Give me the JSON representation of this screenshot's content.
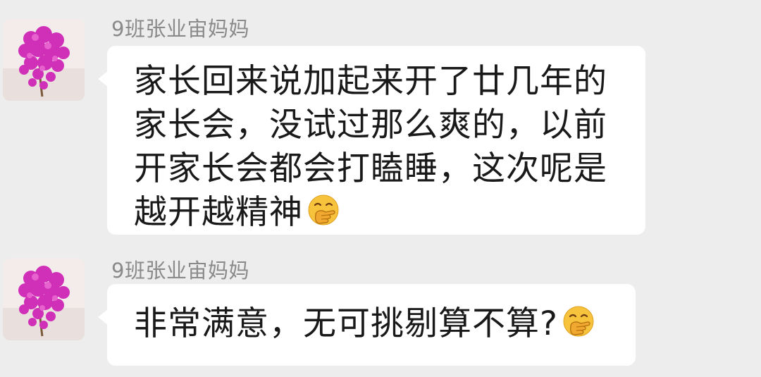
{
  "messages": [
    {
      "sender": "9班张业宙妈妈",
      "text": "家长回来说加起来开了廿几年的家长会，没试过那么爽的，以前开家长会都会打瞌睡，这次呢是越开越精神",
      "emoji": "hand-over-mouth-emoji"
    },
    {
      "sender": "9班张业宙妈妈",
      "text": "非常满意，无可挑剔算不算?",
      "emoji": "hand-over-mouth-emoji"
    }
  ],
  "colors": {
    "background": "#ededed",
    "bubble": "#ffffff",
    "sender_text": "#8a8a8a",
    "message_text": "#191919",
    "avatar_flower": "#d02fb8",
    "emoji_face": "#f7c23c"
  }
}
